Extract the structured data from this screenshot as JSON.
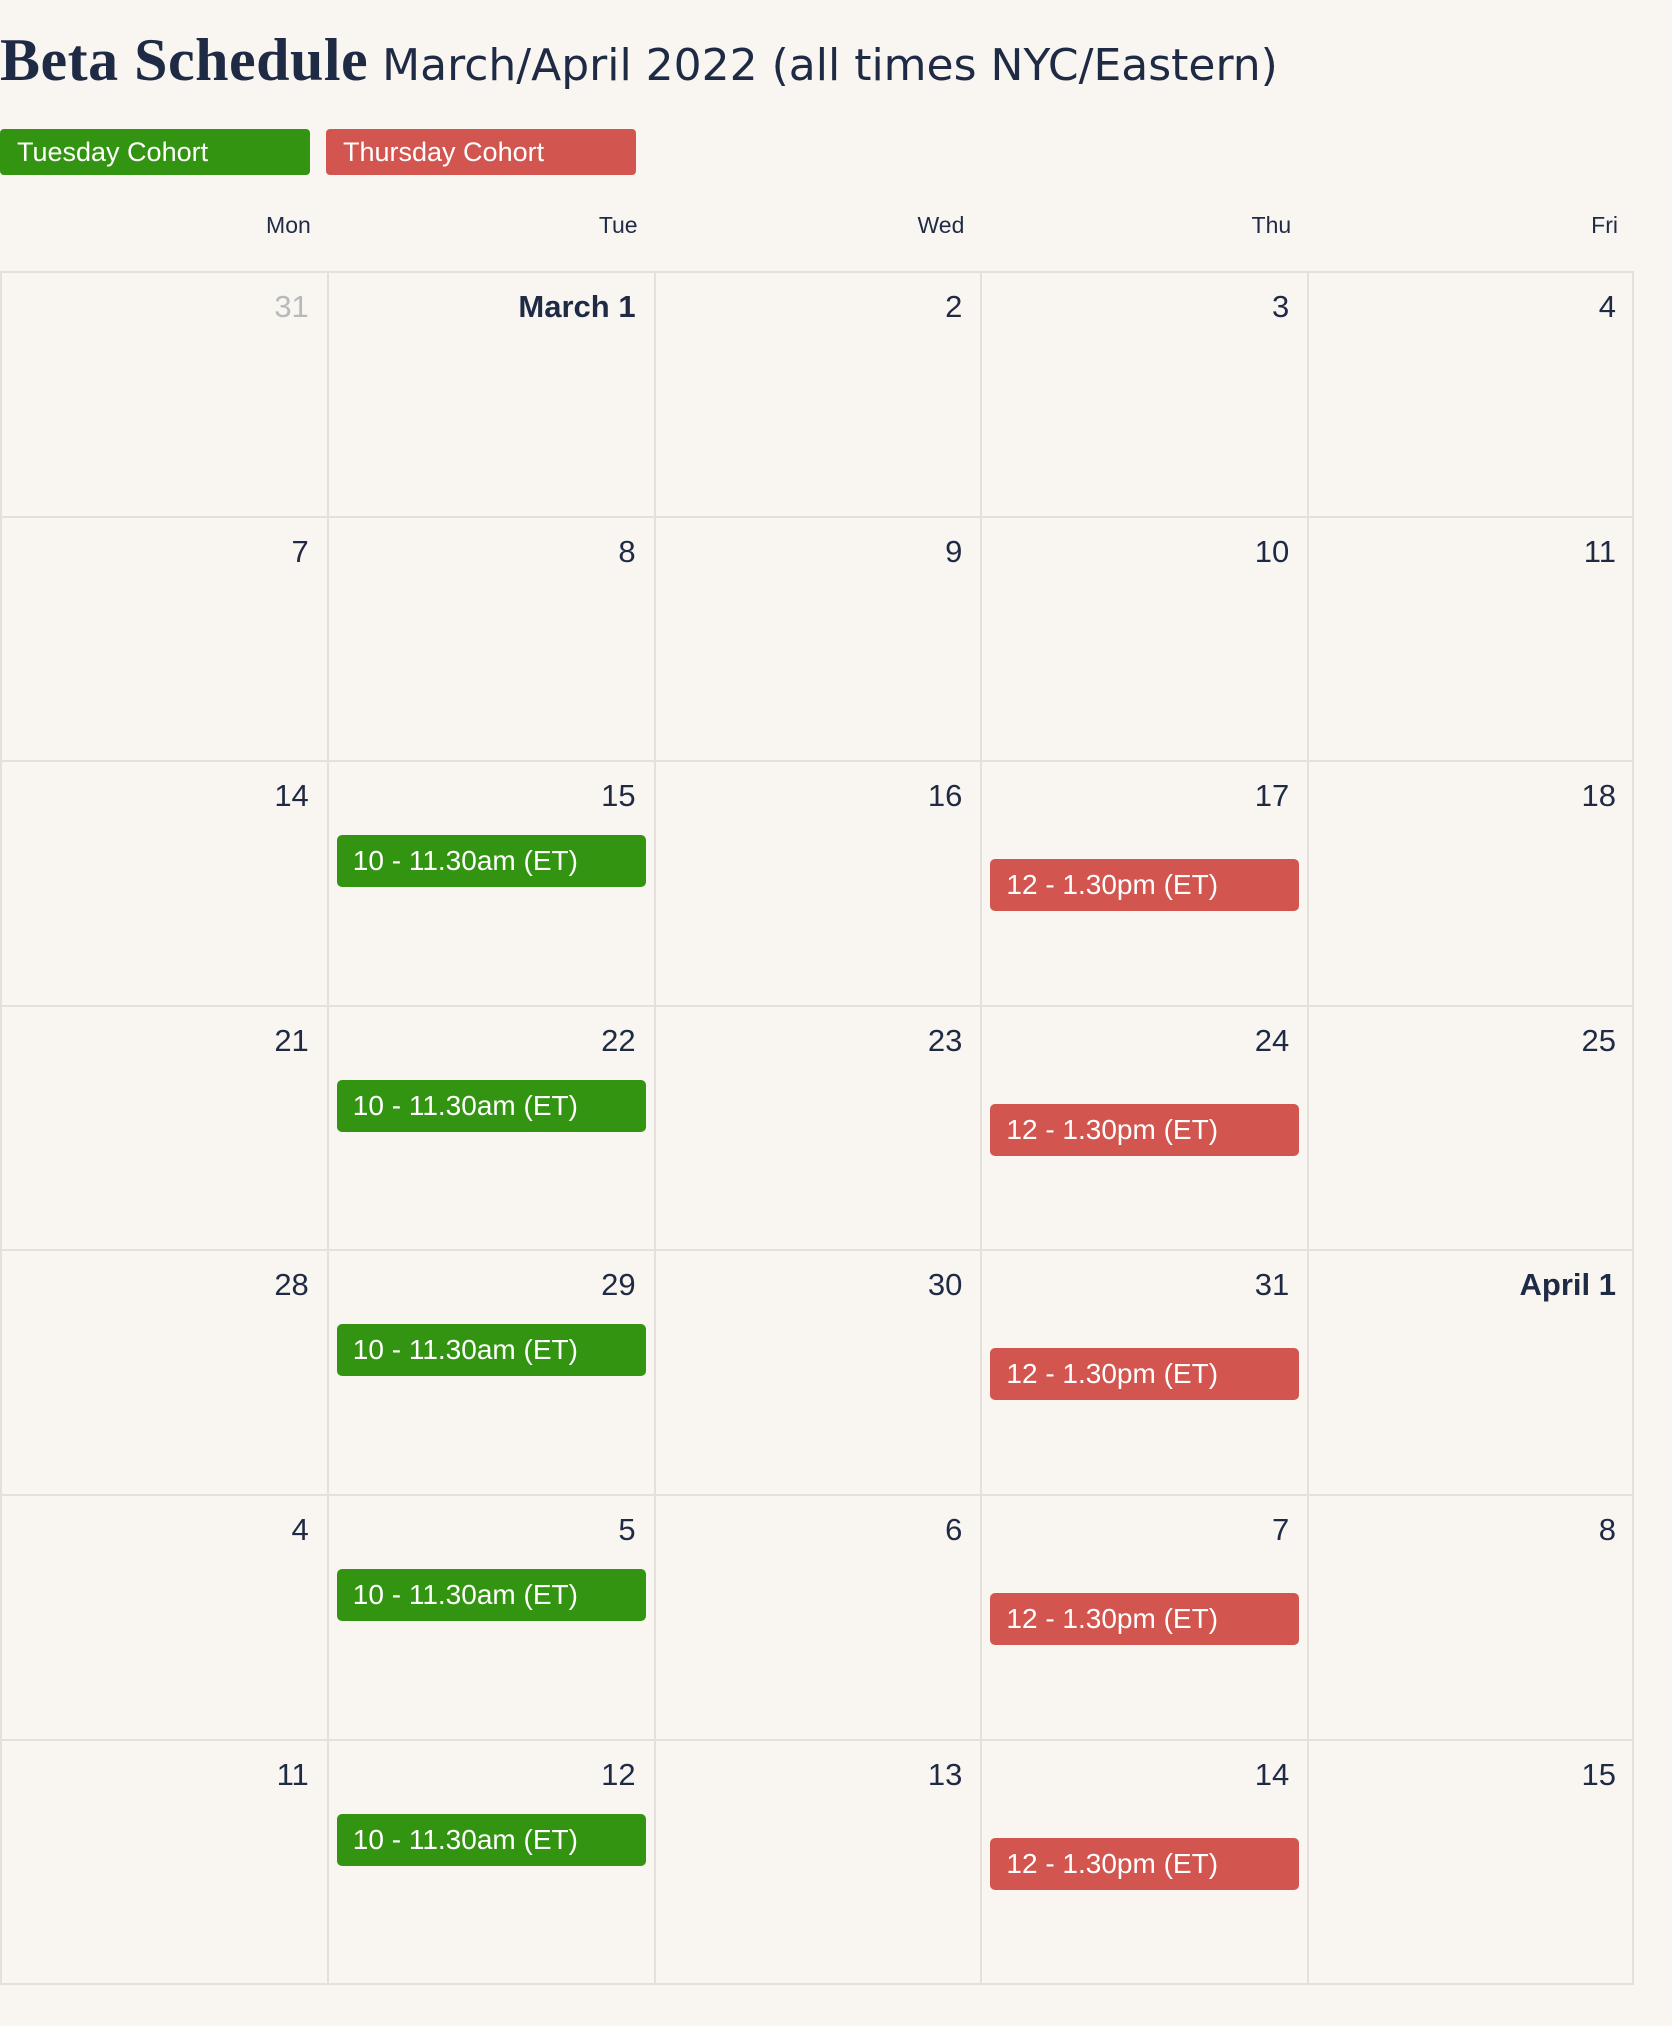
{
  "header": {
    "title": "Beta Schedule",
    "subtitle": "March/April 2022 (all times NYC/Eastern)"
  },
  "legend": [
    {
      "label": "Tuesday Cohort",
      "color": "#339412"
    },
    {
      "label": "Thursday Cohort",
      "color": "#d2554f"
    }
  ],
  "weekdays": [
    "Mon",
    "Tue",
    "Wed",
    "Thu",
    "Fri"
  ],
  "weeks": [
    {
      "days": [
        {
          "label": "31",
          "muted": true
        },
        {
          "label": "March 1",
          "bold": true
        },
        {
          "label": "2"
        },
        {
          "label": "3"
        },
        {
          "label": "4"
        }
      ]
    },
    {
      "days": [
        {
          "label": "7"
        },
        {
          "label": "8"
        },
        {
          "label": "9"
        },
        {
          "label": "10"
        },
        {
          "label": "11"
        }
      ]
    },
    {
      "days": [
        {
          "label": "14"
        },
        {
          "label": "15",
          "event": {
            "cohort": "tue",
            "label": "10 - 11.30am (ET)"
          }
        },
        {
          "label": "16"
        },
        {
          "label": "17",
          "event": {
            "cohort": "thu",
            "label": "12 - 1.30pm (ET)"
          }
        },
        {
          "label": "18"
        }
      ]
    },
    {
      "days": [
        {
          "label": "21"
        },
        {
          "label": "22",
          "event": {
            "cohort": "tue",
            "label": "10 - 11.30am (ET)"
          }
        },
        {
          "label": "23"
        },
        {
          "label": "24",
          "event": {
            "cohort": "thu",
            "label": "12 - 1.30pm (ET)"
          }
        },
        {
          "label": "25"
        }
      ]
    },
    {
      "days": [
        {
          "label": "28"
        },
        {
          "label": "29",
          "event": {
            "cohort": "tue",
            "label": "10 - 11.30am (ET)"
          }
        },
        {
          "label": "30"
        },
        {
          "label": "31",
          "event": {
            "cohort": "thu",
            "label": "12 - 1.30pm (ET)"
          }
        },
        {
          "label": "April 1",
          "bold": true
        }
      ]
    },
    {
      "days": [
        {
          "label": "4"
        },
        {
          "label": "5",
          "event": {
            "cohort": "tue",
            "label": "10 - 11.30am (ET)"
          }
        },
        {
          "label": "6"
        },
        {
          "label": "7",
          "event": {
            "cohort": "thu",
            "label": "12 - 1.30pm (ET)"
          }
        },
        {
          "label": "8"
        }
      ]
    },
    {
      "days": [
        {
          "label": "11"
        },
        {
          "label": "12",
          "event": {
            "cohort": "tue",
            "label": "10 - 11.30am (ET)"
          }
        },
        {
          "label": "13"
        },
        {
          "label": "14",
          "event": {
            "cohort": "thu",
            "label": "12 - 1.30pm (ET)"
          }
        },
        {
          "label": "15"
        }
      ]
    }
  ]
}
